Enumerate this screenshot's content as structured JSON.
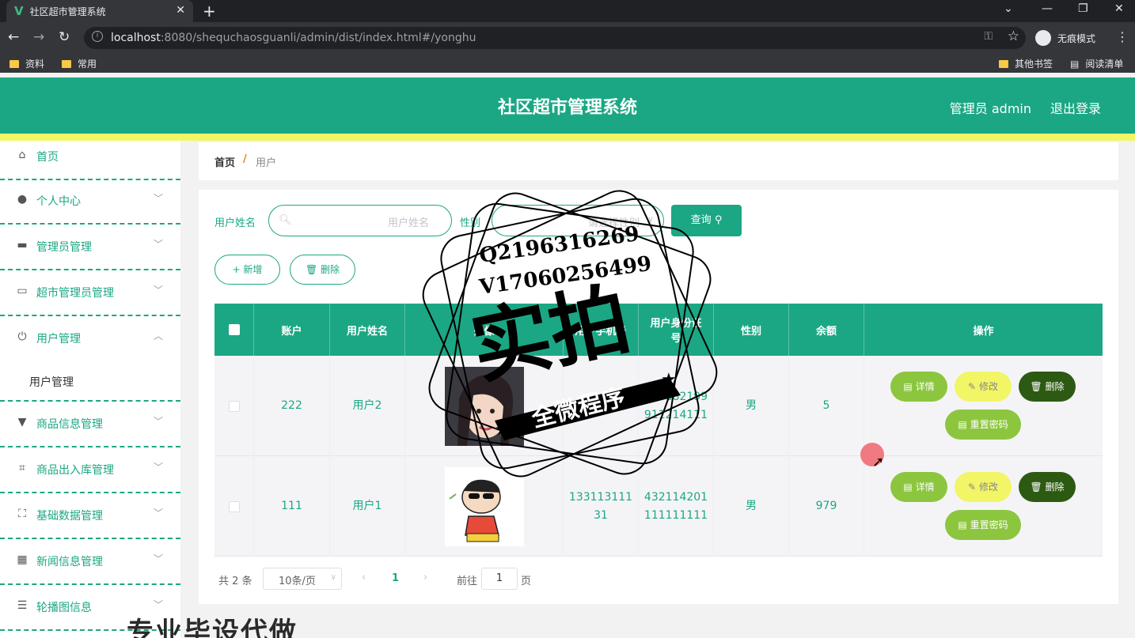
{
  "browser": {
    "tab_title": "社区超市管理系统",
    "url_host": "localhost",
    "url_rest": ":8080/shequchaosguanli/admin/dist/index.html#/yonghu",
    "incognito_label": "无痕模式",
    "bookmarks": [
      "资料",
      "常用"
    ],
    "other_bookmarks": "其他书签",
    "reading_list": "阅读清单"
  },
  "header": {
    "title": "社区超市管理系统",
    "admin_label": "管理员 admin",
    "logout_label": "退出登录"
  },
  "sidebar": {
    "items": [
      {
        "label": "首页",
        "icon": "home-icon"
      },
      {
        "label": "个人中心",
        "icon": "user-icon"
      },
      {
        "label": "管理员管理",
        "icon": "monitor-icon"
      },
      {
        "label": "超市管理员管理",
        "icon": "idcard-icon"
      },
      {
        "label": "用户管理",
        "icon": "power-icon"
      },
      {
        "label": "商品信息管理",
        "icon": "brush-icon"
      },
      {
        "label": "商品出入库管理",
        "icon": "crop-icon"
      },
      {
        "label": "基础数据管理",
        "icon": "fullscreen-icon"
      },
      {
        "label": "新闻信息管理",
        "icon": "grid-icon"
      },
      {
        "label": "轮播图信息",
        "icon": "menu-icon"
      }
    ],
    "sub_item": "用户管理"
  },
  "breadcrumb": {
    "home": "首页",
    "sep": "/",
    "current": "用户"
  },
  "search": {
    "name_label": "用户姓名",
    "name_placeholder": "用户姓名",
    "gender_label": "性别",
    "gender_placeholder": "请选择性别",
    "query_label": "查询"
  },
  "actions": {
    "add_label": "+ 新增",
    "delete_label": "删除"
  },
  "table": {
    "headers": [
      "账户",
      "用户姓名",
      "头像",
      "用户手机号",
      "用户身份证号",
      "性别",
      "余额",
      "操作"
    ],
    "rows": [
      {
        "account": "222",
        "name": "用户2",
        "phone": "",
        "idcard": "430882199 911214111",
        "gender": "男",
        "balance": "5"
      },
      {
        "account": "111",
        "name": "用户1",
        "phone": "133113111 31",
        "idcard": "432114201 111111111",
        "gender": "男",
        "balance": "979"
      }
    ],
    "row_buttons": {
      "detail": "详情",
      "edit": "修改",
      "delete": "删除",
      "reset": "重置密码"
    }
  },
  "pager": {
    "total": "共 2 条",
    "page_size": "10条/页",
    "current": "1",
    "goto": "前往",
    "goto_value": "1",
    "unit": "页"
  },
  "watermark": {
    "line1": "Q2196316269",
    "line2": "V17060256499",
    "big": "实拍",
    "band": "全微程序",
    "bottom": "专业毕设代做"
  },
  "colors": {
    "primary": "#1ba784",
    "yellow": "#f2f565",
    "lime": "#8cc63f",
    "dark_green": "#2d5a12"
  }
}
